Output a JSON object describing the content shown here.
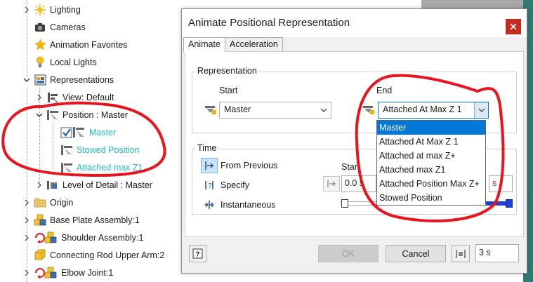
{
  "tree": {
    "items": [
      {
        "label": "Lighting",
        "icon": "lighting-icon"
      },
      {
        "label": "Cameras",
        "icon": "camera-icon"
      },
      {
        "label": "Animation Favorites",
        "icon": "star-icon"
      },
      {
        "label": "Local Lights",
        "icon": "bulb-icon"
      },
      {
        "label": "Representations",
        "icon": "representations-icon"
      },
      {
        "label": "View: Default",
        "icon": "view-rep-icon"
      },
      {
        "label": "Position : Master",
        "icon": "position-rep-icon"
      },
      {
        "label": "Master",
        "icon": "position-item-icon"
      },
      {
        "label": "Stowed Position",
        "icon": "position-item-icon"
      },
      {
        "label": "Attached max Z1",
        "icon": "position-item-icon"
      },
      {
        "label": "Level of Detail : Master",
        "icon": "lod-icon"
      },
      {
        "label": "Origin",
        "icon": "folder-icon"
      },
      {
        "label": "Base Plate Assembly:1",
        "icon": "assembly-icon"
      },
      {
        "label": "Shoulder Assembly:1",
        "icon": "assembly-rotate-icon"
      },
      {
        "label": "Connecting Rod Upper Arm:2",
        "icon": "part-icon"
      },
      {
        "label": "Elbow Joint:1",
        "icon": "assembly-rotate-icon"
      }
    ]
  },
  "dialog": {
    "title": "Animate Positional Representation",
    "tabs": [
      "Animate",
      "Acceleration"
    ],
    "representation": {
      "group_title": "Representation",
      "start_label": "Start",
      "end_label": "End",
      "start_value": "Master",
      "end_value": "Attached At Max Z 1",
      "options": [
        "Master",
        "Attached At Max Z 1",
        "Attached at max Z+",
        "Attached max Z1",
        "Attached Position Max Z+",
        "Stowed Position"
      ],
      "selected_option": "Master"
    },
    "time": {
      "group_title": "Time",
      "from_previous": "From Previous",
      "specify": "Specify",
      "instantaneous": "Instantaneous",
      "start_label": "Start",
      "start_value": "0.0 s",
      "end_partial": "s"
    },
    "buttons": {
      "ok": "OK",
      "cancel": "Cancel",
      "duration": "3 s"
    }
  },
  "colors": {
    "accent": "#0078d7",
    "cyan_text": "#1fb8c4",
    "annotation": "#e8141e",
    "close": "#c42b1c"
  }
}
